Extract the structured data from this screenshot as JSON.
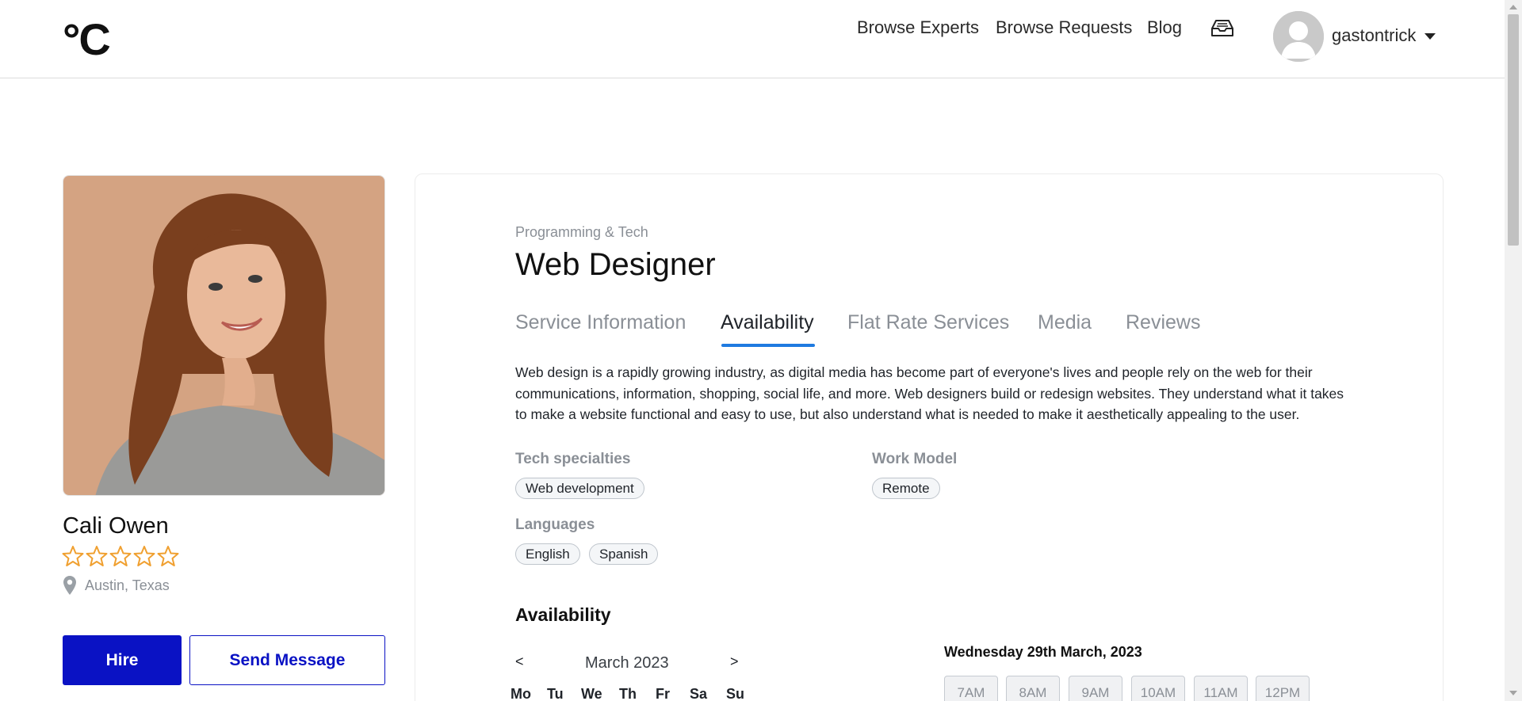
{
  "header": {
    "logo": "°C",
    "nav": [
      "Browse Experts",
      "Browse Requests",
      "Blog"
    ],
    "inbox_icon": "inbox-tray-icon",
    "username": "gastontrick"
  },
  "profile": {
    "name": "Cali Owen",
    "rating": 0,
    "max_rating": 5,
    "location": "Austin, Texas",
    "hire_label": "Hire",
    "message_label": "Send Message"
  },
  "service": {
    "category": "Programming & Tech",
    "title": "Web Designer",
    "tabs": [
      "Service Information",
      "Availability",
      "Flat Rate Services",
      "Media",
      "Reviews"
    ],
    "active_tab": "Availability",
    "description": "Web design is a rapidly growing industry, as digital media has become part of everyone's lives and people rely on the web for their communications, information, shopping, social life, and more. Web designers build or redesign websites. They understand what it takes to make a website functional and easy to use, but also understand what is needed to make it aesthetically appealing to the user.",
    "tech_label": "Tech specialties",
    "tech": [
      "Web development"
    ],
    "work_model_label": "Work Model",
    "work_model": [
      "Remote"
    ],
    "languages_label": "Languages",
    "languages": [
      "English",
      "Spanish"
    ]
  },
  "availability": {
    "heading": "Availability",
    "prev": "<",
    "next": ">",
    "month": "March 2023",
    "weekdays": [
      "Mo",
      "Tu",
      "We",
      "Th",
      "Fr",
      "Sa",
      "Su"
    ],
    "selected_date": "Wednesday 29th March, 2023",
    "slots": [
      "7AM",
      "8AM",
      "9AM",
      "10AM",
      "11AM",
      "12PM"
    ]
  },
  "colors": {
    "primary": "#0a12c4",
    "tab_underline": "#1f7ae0",
    "star": "#f0a030",
    "muted_text": "#8a8f96"
  }
}
